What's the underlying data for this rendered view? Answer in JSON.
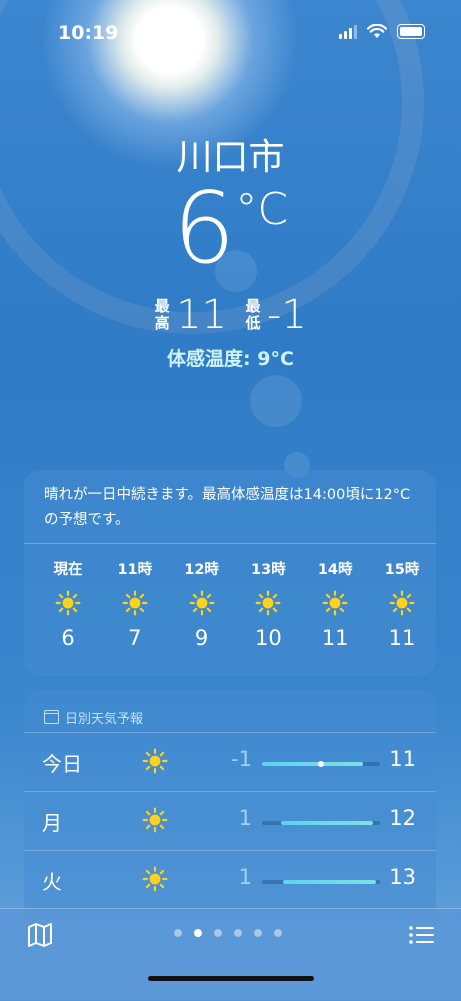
{
  "status_bar": {
    "time": "10:19"
  },
  "location": {
    "city": "川口市"
  },
  "current": {
    "temp": "6",
    "unit": "°C",
    "high_label": "最\n高",
    "high": "11",
    "low_label": "最\n低",
    "low": "-1",
    "feels_like": "体感温度: 9°C"
  },
  "hourly": {
    "summary": "晴れが一日中続きます。最高体感温度は14:00頃に12°Cの予想です。",
    "hours": [
      {
        "label": "現在",
        "icon": "sun-icon",
        "temp": "6"
      },
      {
        "label": "11時",
        "icon": "sun-icon",
        "temp": "7"
      },
      {
        "label": "12時",
        "icon": "sun-icon",
        "temp": "9"
      },
      {
        "label": "13時",
        "icon": "sun-icon",
        "temp": "10"
      },
      {
        "label": "14時",
        "icon": "sun-icon",
        "temp": "11"
      },
      {
        "label": "15時",
        "icon": "sun-icon",
        "temp": "11"
      }
    ]
  },
  "daily": {
    "header": "日別天気予報",
    "days": [
      {
        "day": "今日",
        "icon": "sun-icon",
        "low": "-1",
        "high": "11",
        "range_start": 0.0,
        "range_end": 0.86,
        "current_marker": 0.5
      },
      {
        "day": "月",
        "icon": "sun-icon",
        "low": "1",
        "high": "12",
        "range_start": 0.16,
        "range_end": 0.94
      },
      {
        "day": "火",
        "icon": "sun-icon",
        "low": "1",
        "high": "13",
        "range_start": 0.18,
        "range_end": 0.97
      }
    ]
  },
  "pager": {
    "pages": 6,
    "active_index": 1
  },
  "colors": {
    "sun": "#ffd21a",
    "accent": "#cdf3ff",
    "bar_fill": "#6ad8ea"
  }
}
